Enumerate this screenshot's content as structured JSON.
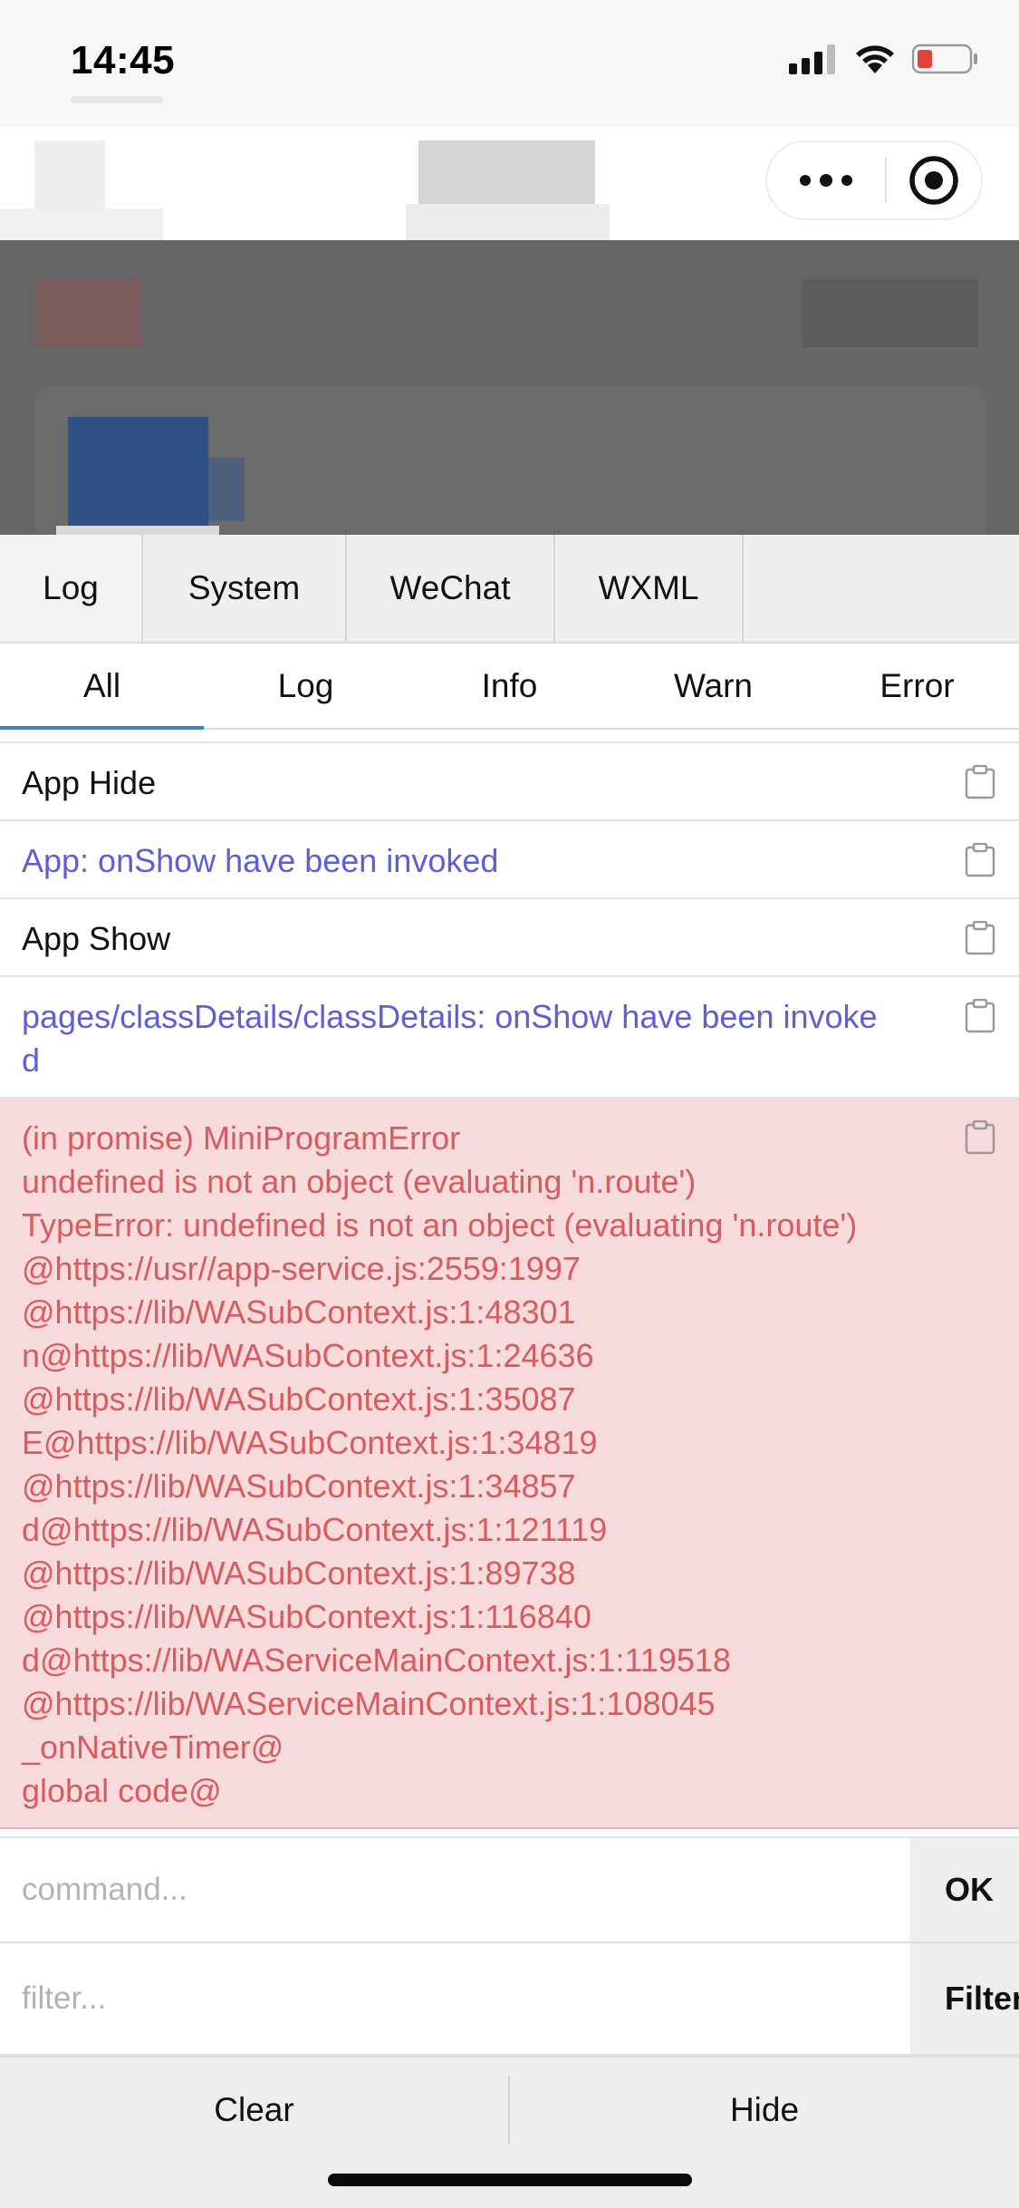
{
  "status_bar": {
    "time": "14:45"
  },
  "capsule": {
    "more_icon": "more-dots-icon",
    "target_icon": "target-circle-icon"
  },
  "tabs": [
    {
      "label": "Log",
      "active": true
    },
    {
      "label": "System",
      "active": false
    },
    {
      "label": "WeChat",
      "active": false
    },
    {
      "label": "WXML",
      "active": false
    }
  ],
  "filters": [
    {
      "label": "All",
      "active": true
    },
    {
      "label": "Log",
      "active": false
    },
    {
      "label": "Info",
      "active": false
    },
    {
      "label": "Warn",
      "active": false
    },
    {
      "label": "Error",
      "active": false
    }
  ],
  "logs": [
    {
      "level": "plain",
      "lines": [
        "App Hide"
      ]
    },
    {
      "level": "info",
      "lines": [
        "App: onShow have been invoked"
      ]
    },
    {
      "level": "plain",
      "lines": [
        "App Show"
      ]
    },
    {
      "level": "info",
      "lines": [
        "pages/classDetails/classDetails: onShow have been invoke",
        "d"
      ]
    },
    {
      "level": "error",
      "lines": [
        "(in promise) MiniProgramError",
        "undefined is not an object (evaluating 'n.route')",
        "TypeError: undefined is not an object (evaluating 'n.route')",
        "@https://usr//app-service.js:2559:1997",
        "@https://lib/WASubContext.js:1:48301",
        "n@https://lib/WASubContext.js:1:24636",
        "@https://lib/WASubContext.js:1:35087",
        "E@https://lib/WASubContext.js:1:34819",
        "@https://lib/WASubContext.js:1:34857",
        "d@https://lib/WASubContext.js:1:121119",
        "@https://lib/WASubContext.js:1:89738",
        "@https://lib/WASubContext.js:1:116840",
        "d@https://lib/WAServiceMainContext.js:1:119518",
        "@https://lib/WAServiceMainContext.js:1:108045",
        "_onNativeTimer@",
        "global code@"
      ]
    }
  ],
  "command": {
    "placeholder": "command...",
    "value": "",
    "button_label": "OK"
  },
  "filter_input": {
    "placeholder": "filter...",
    "value": "",
    "button_label": "Filter"
  },
  "bottom": {
    "clear_label": "Clear",
    "hide_label": "Hide"
  }
}
